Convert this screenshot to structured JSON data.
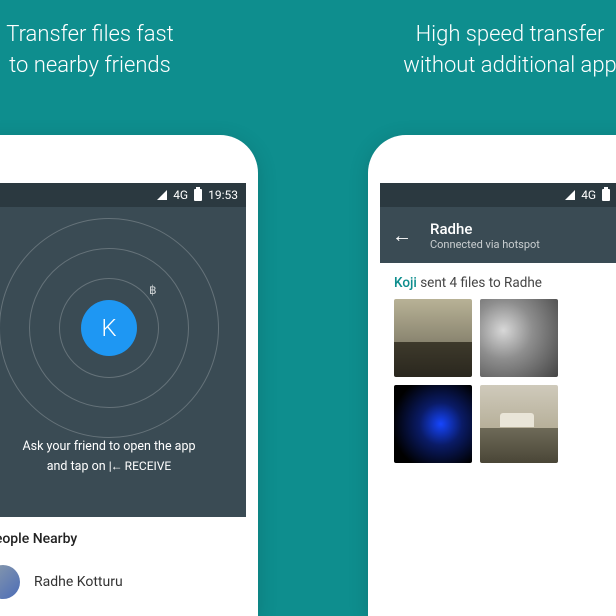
{
  "promo": {
    "left_line1": "Transfer files fast",
    "left_line2": "to nearby friends",
    "right_line1": "High speed transfer",
    "right_line2": "without additional app"
  },
  "status": {
    "network": "4G",
    "time": "19:53"
  },
  "left_screen": {
    "avatar_initial": "K",
    "instruction_line1": "Ask your friend to open the app",
    "instruction_line2_prefix": "and tap on",
    "receive_icon": "|←",
    "receive_label": "RECEIVE",
    "section_heading": "People Nearby",
    "nearby": [
      {
        "name": "Radhe Kotturu"
      }
    ]
  },
  "right_screen": {
    "title": "Radhe",
    "subtitle": "Connected via hotspot",
    "sent_sender": "Koji",
    "sent_mid": " sent 4 files to ",
    "sent_target": "Radhe"
  }
}
